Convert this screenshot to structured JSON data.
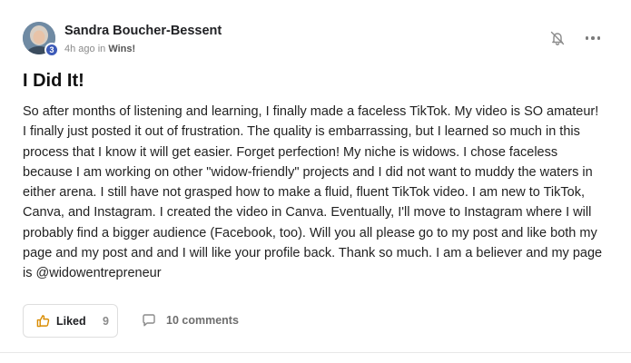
{
  "post": {
    "author": {
      "name": "Sandra Boucher-Bessent",
      "level": "3"
    },
    "meta": {
      "time": "4h ago in",
      "category": "Wins!"
    },
    "title": "I Did It!",
    "body": "So after months of listening and learning, I finally made a faceless TikTok. My video is SO amateur! I finally just posted it out of frustration. The quality is embarrassing, but I learned so much in this process that I know it will get easier. Forget perfection! My niche is widows. I chose faceless because I am working on other \"widow-friendly\" projects and I did not want to muddy the waters in either arena. I still have not grasped how to make a fluid, fluent TikTok video. I am new to TikTok, Canva, and Instagram. I created the video in Canva. Eventually, I'll move to Instagram where I will probably find a bigger audience (Facebook, too). Will you all please go to my post and like both my page and my post and and I will like your profile back. Thank so much. I am a believer and my page is @widowentrepreneur",
    "actions": {
      "like_label": "Liked",
      "like_count": "9",
      "comments_label": "10 comments"
    },
    "icons": {
      "notify": "bell-off-icon",
      "more": "more-horizontal-icon",
      "like": "thumbs-up-icon",
      "comment": "comment-icon"
    },
    "colors": {
      "badge": "#3c5ab8",
      "text": "#222222",
      "muted": "#8a8a8a"
    }
  }
}
